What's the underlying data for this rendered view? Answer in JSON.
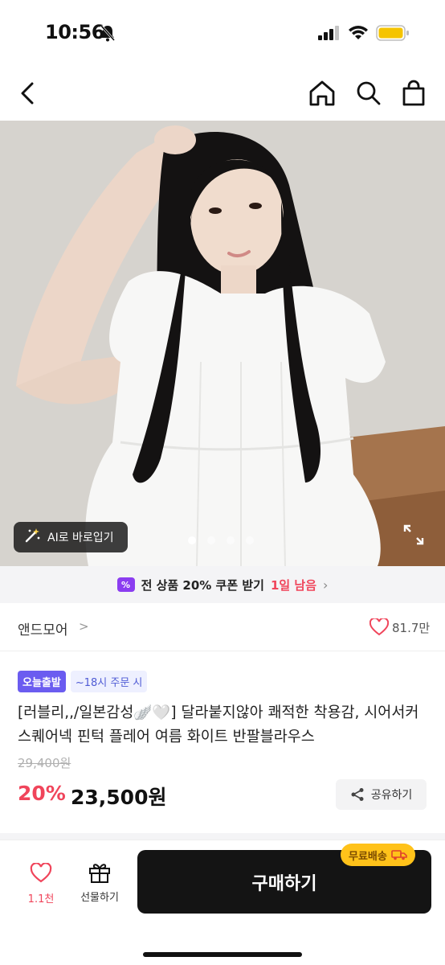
{
  "status": {
    "time": "10:56"
  },
  "hero": {
    "ai_button_label": "AI로 바로입기",
    "dots": 4,
    "active_dot": 0
  },
  "coupon": {
    "prefix": "전 상품 20% 쿠폰 받기",
    "accent": "1일 남음",
    "icon_label": "%"
  },
  "brand": {
    "name": "앤드모어",
    "chevron": ">",
    "likes": "81.7만"
  },
  "badges": {
    "today": "오늘출발",
    "order": "~18시 주문 시"
  },
  "product": {
    "title": "[러블리,,/일본감성🪽🤍] 달라붙지않아 쾌적한 착용감, 시어서커 스퀘어넥 핀턱 플레어 여름 화이트 반팔블라우스",
    "original_price": "29,400원",
    "discount": "20%",
    "price": "23,500원",
    "share_label": "공유하기"
  },
  "bottom": {
    "wish_count": "1.1천",
    "gift_label": "선물하기",
    "buy_label": "구매하기",
    "free_shipping": "무료배송"
  },
  "colors": {
    "accent_red": "#f0455b",
    "badge_purple": "#6b5cf0",
    "buy_black": "#141414",
    "ship_yellow": "#ffc21a",
    "battery": "#f5c400"
  }
}
